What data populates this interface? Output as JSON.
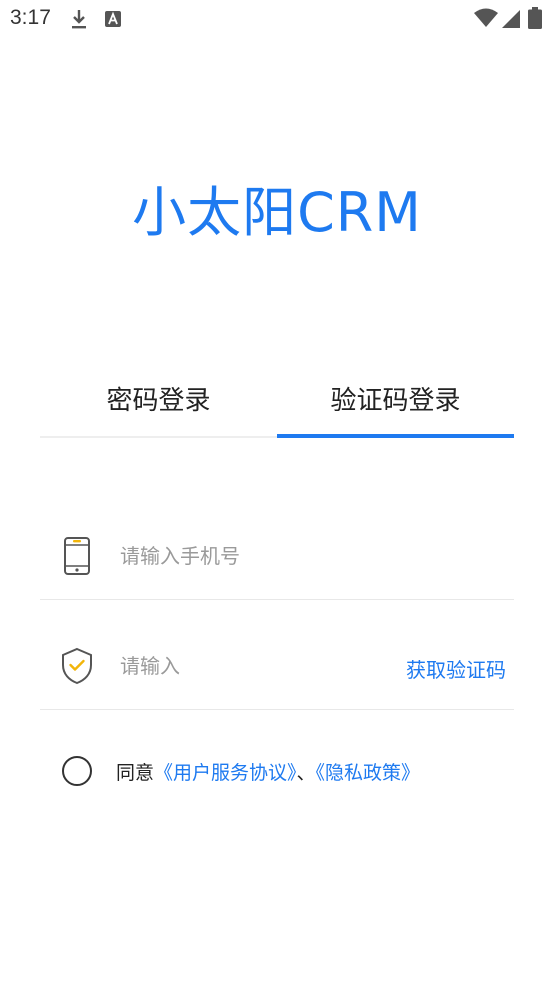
{
  "status_bar": {
    "time": "3:17",
    "icons": [
      "download-icon",
      "font-a-icon",
      "wifi-icon",
      "signal-icon",
      "battery-icon"
    ]
  },
  "app": {
    "title": "小太阳CRM"
  },
  "tabs": [
    {
      "label": "密码登录",
      "active": false
    },
    {
      "label": "验证码登录",
      "active": true
    }
  ],
  "form": {
    "phone_placeholder": "请输入手机号",
    "code_placeholder": "请输入",
    "get_code_label": "获取验证码"
  },
  "agreement": {
    "checked": false,
    "prefix": "同意",
    "user_agreement": "《用户服务协议》",
    "separator": "、",
    "privacy_policy": "《隐私政策》"
  },
  "colors": {
    "accent": "#1e7af0",
    "shield_check": "#f2b50a",
    "phone_highlight": "#f2b50a"
  }
}
